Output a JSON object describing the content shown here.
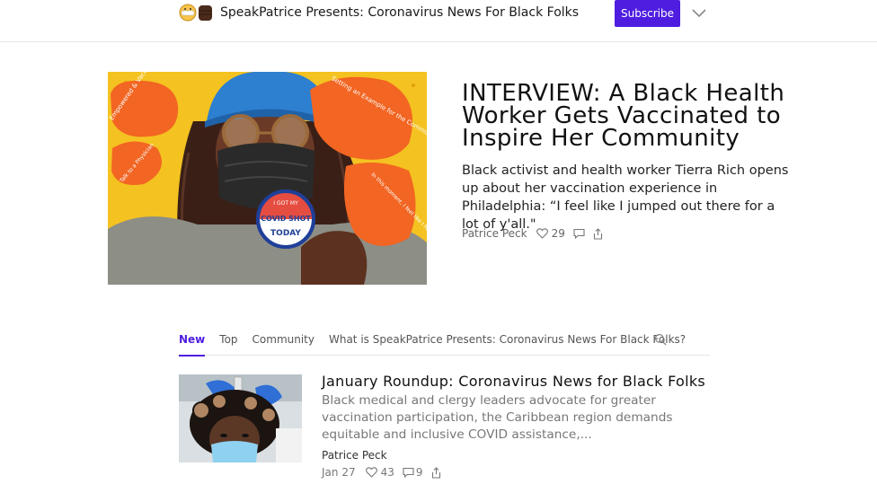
{
  "header": {
    "publication_title": "SpeakPatrice Presents: Coronavirus News For Black Folks",
    "subscribe_label": "Subscribe"
  },
  "featured": {
    "title": "INTERVIEW: A Black Health Worker Gets Vaccinated to Inspire Her Community",
    "subtitle": "Black activist and health worker Tierra Rich opens up about her vaccination experience in Philadelphia: “I feel like I jumped out there for a lot of y'all.\"",
    "author": "Patrice Peck",
    "likes": "29",
    "image": {
      "bubble_texts": [
        "Empowered & Vaccinated",
        "Talk to a Physician",
        "Setting an Example for the Community",
        "In this moment, I feel like I had to do it!"
      ],
      "button_text_top": "I GOT MY",
      "button_text_mid": "COVID SHOT",
      "button_text_bot": "TODAY"
    }
  },
  "tabs": [
    {
      "label": "New",
      "active": true
    },
    {
      "label": "Top",
      "active": false
    },
    {
      "label": "Community",
      "active": false
    },
    {
      "label": "What is SpeakPatrice Presents: Coronavirus News For Black Folks?",
      "active": false
    }
  ],
  "posts": [
    {
      "title": "January Roundup: Coronavirus News for Black Folks",
      "excerpt": "Black medical and clergy leaders advocate for greater vaccination participation, the Caribbean region demands equitable and inclusive COVID assistance,...",
      "author": "Patrice Peck",
      "date": "Jan 27",
      "likes": "43",
      "comments": "9"
    }
  ],
  "colors": {
    "accent": "#4f1de0",
    "illustration_background": "#f4c221",
    "bubble": "#f26522"
  },
  "icons": [
    "logo-emoji-icon",
    "chevron-down-icon",
    "heart-icon",
    "comment-icon",
    "share-icon",
    "search-icon"
  ]
}
